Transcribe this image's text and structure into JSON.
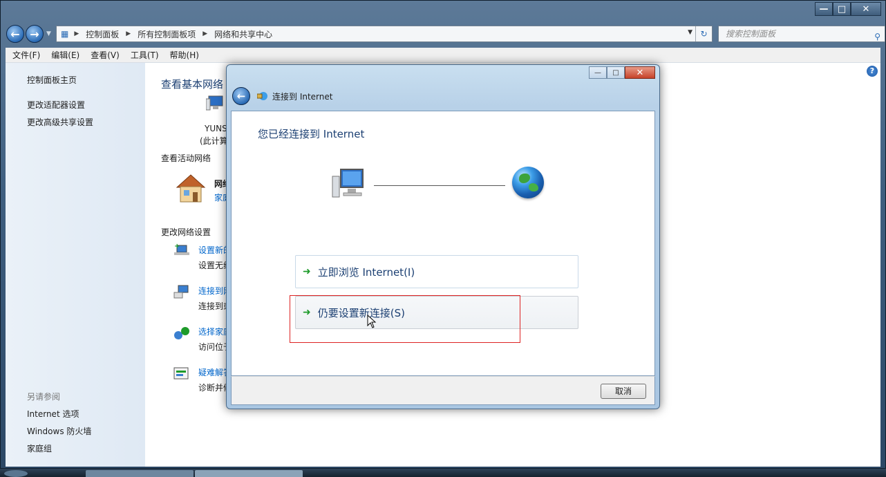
{
  "window": {
    "controls": {
      "minimize": "—",
      "maximize": "□",
      "close": "✕"
    }
  },
  "nav": {
    "breadcrumbs": [
      "控制面板",
      "所有控制面板项",
      "网络和共享中心"
    ],
    "search_placeholder": "搜索控制面板"
  },
  "menu": [
    "文件(F)",
    "编辑(E)",
    "查看(V)",
    "工具(T)",
    "帮助(H)"
  ],
  "sidebar": {
    "links": [
      "控制面板主页",
      "更改适配器设置",
      "更改高级共享设置"
    ],
    "see_also_label": "另请参阅",
    "see_also": [
      "Internet 选项",
      "Windows 防火墙",
      "家庭组"
    ]
  },
  "main": {
    "title": "查看基本网络",
    "computer_name": "YUNS",
    "computer_sub": "(此计算",
    "active_networks_label": "查看活动网络",
    "network_name": "网络",
    "network_type": "家庭",
    "change_settings_label": "更改网络设置",
    "tasks": [
      {
        "link": "设置新的",
        "desc": "设置无线"
      },
      {
        "link": "连接到网",
        "desc": "连接到或"
      },
      {
        "link": "选择家庭",
        "desc": "访问位于"
      },
      {
        "link": "疑难解答",
        "desc": "诊断并修"
      }
    ]
  },
  "dialog": {
    "title": "连接到 Internet",
    "heading": "您已经连接到 Internet",
    "options": [
      {
        "label": "立即浏览 Internet(I)"
      },
      {
        "label": "仍要设置新连接(S)"
      }
    ],
    "cancel": "取消",
    "controls": {
      "minimize": "—",
      "maximize": "□",
      "close": "✕"
    }
  },
  "colors": {
    "link": "#0066cc",
    "heading": "#1b3f72",
    "arrow": "#1e9b2a",
    "highlight": "#dd2222"
  }
}
